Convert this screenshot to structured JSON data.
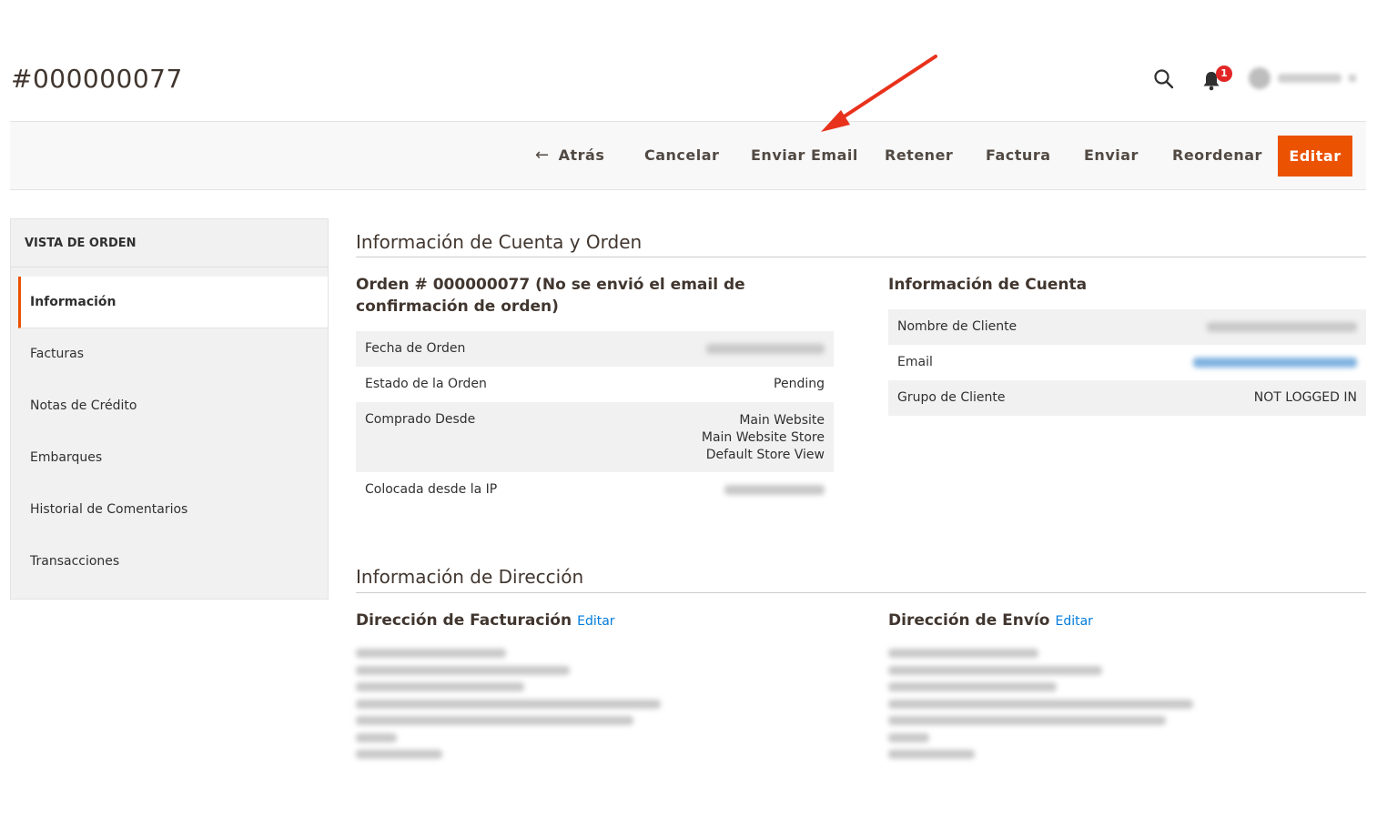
{
  "header": {
    "order_number": "#000000077",
    "search_icon": "search-icon",
    "notifications_count": "1",
    "user_name": "[redacted]"
  },
  "actions": {
    "back": "Atrás",
    "cancel": "Cancelar",
    "send_email": "Enviar Email",
    "hold": "Retener",
    "invoice": "Factura",
    "ship": "Enviar",
    "reorder": "Reordenar",
    "edit": "Editar"
  },
  "sidebar": {
    "title": "VISTA DE ORDEN",
    "items": [
      {
        "label": "Información",
        "active": true
      },
      {
        "label": "Facturas"
      },
      {
        "label": "Notas de Crédito"
      },
      {
        "label": "Embarques"
      },
      {
        "label": "Historial de Comentarios"
      },
      {
        "label": "Transacciones"
      }
    ]
  },
  "account_order": {
    "section_title": "Información de Cuenta y Orden",
    "order_heading": "Orden # 000000077 (No se envió el email de confirmación de orden)",
    "rows": {
      "order_date_label": "Fecha de Orden",
      "order_date_value": "[blurred]",
      "status_label": "Estado de la Orden",
      "status_value": "Pending",
      "purchased_from_label": "Comprado Desde",
      "purchased_from_values": [
        "Main Website",
        "Main Website Store",
        "Default Store View"
      ],
      "ip_label": "Colocada desde la IP",
      "ip_value": "[blurred]"
    }
  },
  "account_info": {
    "heading": "Información de Cuenta",
    "customer_name_label": "Nombre de Cliente",
    "customer_name_value": "[blurred]",
    "email_label": "Email",
    "email_value": "[blurred]",
    "customer_group_label": "Grupo de Cliente",
    "customer_group_value": "NOT LOGGED IN"
  },
  "address": {
    "section_title": "Información de Dirección",
    "billing_heading": "Dirección de Facturación",
    "shipping_heading": "Dirección de Envío",
    "edit_label": "Editar",
    "billing_lines_blurred": 7,
    "shipping_lines_blurred": 7
  },
  "colors": {
    "accent": "#eb5202",
    "link": "#007bdb",
    "annotation_arrow": "#e8321c",
    "badge": "#e22626"
  }
}
